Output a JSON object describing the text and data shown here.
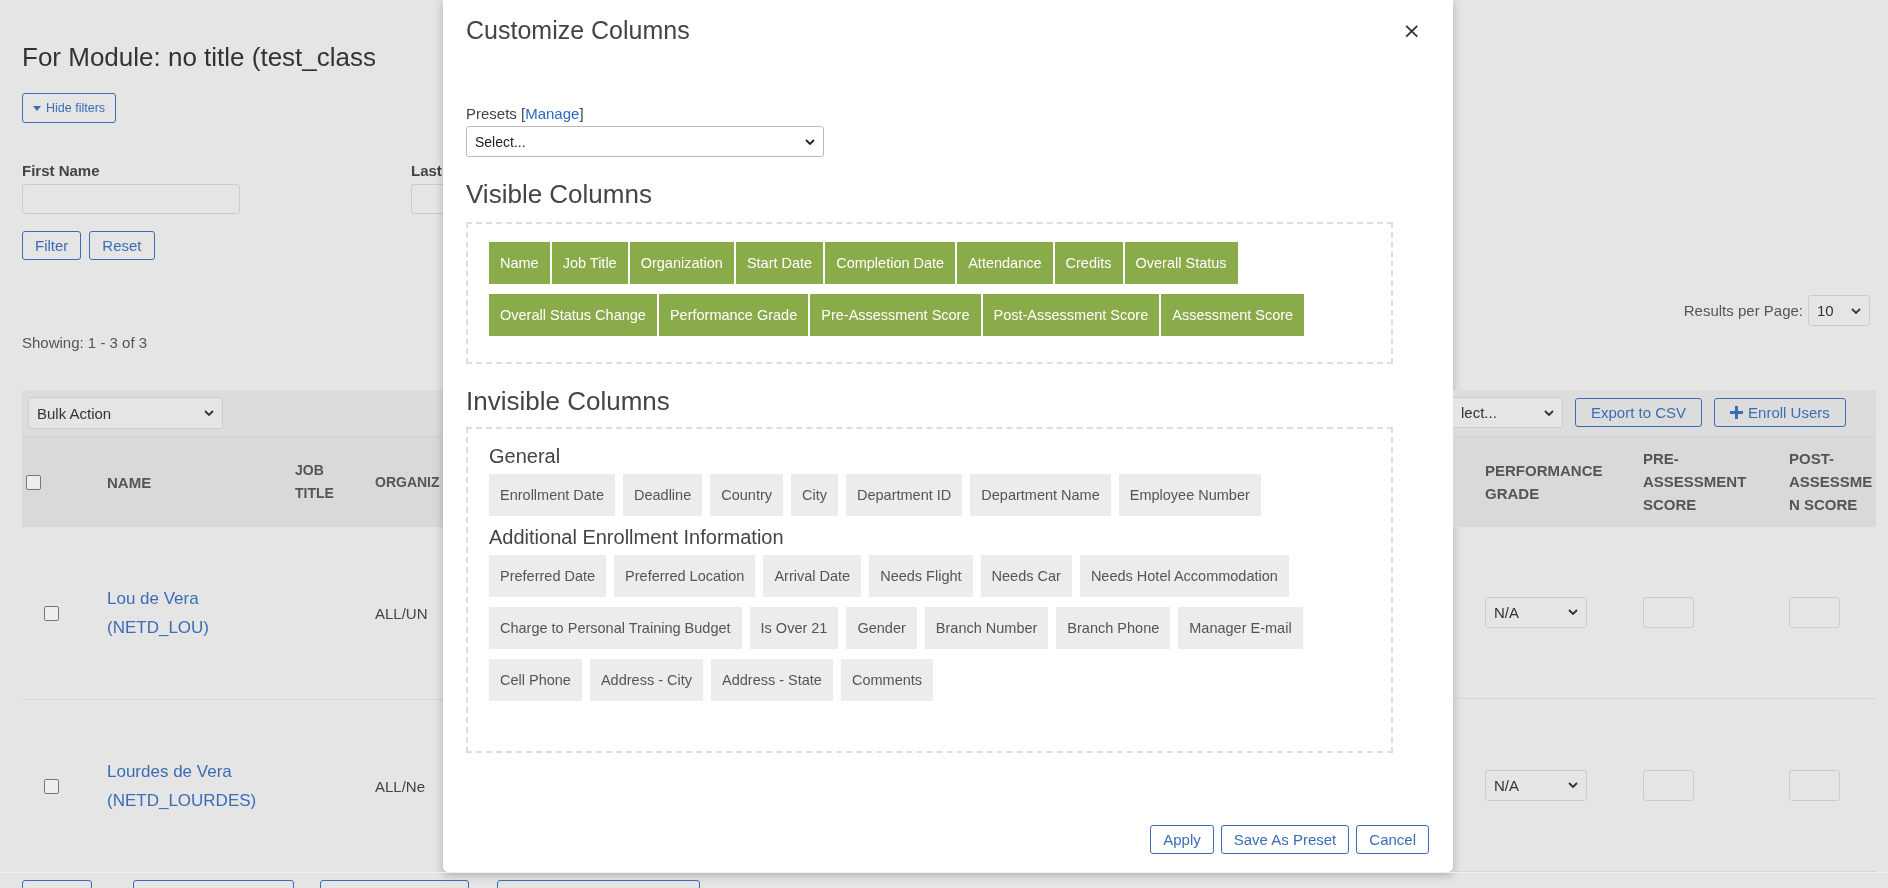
{
  "page": {
    "title": "For Module: no title (test_class",
    "filters_toggle": "Hide filters",
    "filters": [
      {
        "label": "First Name"
      },
      {
        "label": "Last"
      }
    ],
    "filter_buttons": [
      "Filter",
      "Reset"
    ],
    "showing": "Showing: 1 - 3 of 3",
    "results_per_page": {
      "label": "Results per Page:",
      "value": "10"
    },
    "bulk_action": "Bulk Action",
    "toolbar": {
      "select": "lect...",
      "buttons": [
        "Export to CSV",
        "Enroll Users"
      ]
    },
    "table": {
      "header_checked": false,
      "left_columns": [
        "NAME",
        "JOB TITLE",
        "ORGANIZ"
      ],
      "right_columns": [
        "PERFORMANCE GRADE",
        "PRE-ASSESSMENT SCORE",
        "POST-ASSESSMEN SCORE"
      ],
      "rows": [
        {
          "checked": false,
          "name": "Lou de Vera (NETD_LOU)",
          "organization": "ALL/UN",
          "grade": "N/A"
        },
        {
          "checked": false,
          "name": "Lourdes de Vera (NETD_LOURDES)",
          "organization": "ALL/Ne",
          "grade": "N/A"
        }
      ]
    }
  },
  "dialog": {
    "title": "Customize Columns",
    "close": "×",
    "presets_label": "Presets [",
    "presets_link": "Manage",
    "presets_end": "]",
    "presets_select": "Select...",
    "visible_heading": "Visible Columns",
    "visible_columns": [
      "Name",
      "Job Title",
      "Organization",
      "Start Date",
      "Completion Date",
      "Attendance",
      "Credits",
      "Overall Status",
      "Overall Status Change",
      "Performance Grade",
      "Pre-Assessment Score",
      "Post-Assessment Score",
      "Assessment Score"
    ],
    "invisible_heading": "Invisible Columns",
    "invisible_groups": [
      {
        "title": "General",
        "columns": [
          "Enrollment Date",
          "Deadline",
          "Country",
          "City",
          "Department ID",
          "Department Name",
          "Employee Number"
        ]
      },
      {
        "title": "Additional Enrollment Information",
        "columns": [
          "Preferred Date",
          "Preferred Location",
          "Arrival Date",
          "Needs Flight",
          "Needs Car",
          "Needs Hotel Accommodation",
          "Charge to Personal Training Budget",
          "Is Over 21",
          "Gender",
          "Branch Number",
          "Branch Phone",
          "Manager E-mail",
          "Cell Phone",
          "Address - City",
          "Address - State",
          "Comments"
        ]
      }
    ],
    "buttons": [
      "Apply",
      "Save As Preset",
      "Cancel"
    ]
  }
}
